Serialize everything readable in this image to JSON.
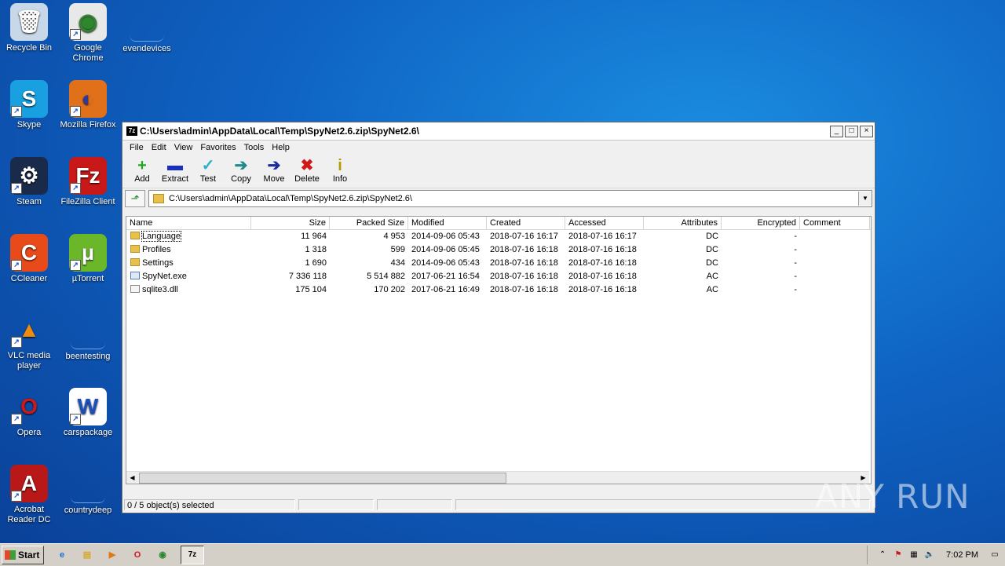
{
  "desktop": {
    "icons": [
      {
        "label": "Recycle Bin",
        "icon": "recycle-bin"
      },
      {
        "label": "Google Chrome",
        "icon": "chrome"
      },
      {
        "label": "evendevices",
        "icon": "blank"
      },
      {
        "label": "Skype",
        "icon": "skype"
      },
      {
        "label": "Mozilla Firefox",
        "icon": "firefox"
      },
      {
        "label": "Steam",
        "icon": "steam"
      },
      {
        "label": "FileZilla Client",
        "icon": "filezilla"
      },
      {
        "label": "CCleaner",
        "icon": "ccleaner"
      },
      {
        "label": "µTorrent",
        "icon": "utorrent"
      },
      {
        "label": "VLC media player",
        "icon": "vlc"
      },
      {
        "label": "beentesting",
        "icon": "blank"
      },
      {
        "label": "Opera",
        "icon": "opera"
      },
      {
        "label": "carspackage",
        "icon": "word-doc"
      },
      {
        "label": "Acrobat Reader DC",
        "icon": "acrobat"
      },
      {
        "label": "countrydeep",
        "icon": "blank"
      }
    ]
  },
  "window": {
    "title": "C:\\Users\\admin\\AppData\\Local\\Temp\\SpyNet2.6.zip\\SpyNet2.6\\",
    "app_icon": "7z",
    "controls": {
      "minimize": "_",
      "maximize": "□",
      "close": "×"
    },
    "menu": [
      "File",
      "Edit",
      "View",
      "Favorites",
      "Tools",
      "Help"
    ],
    "toolbar": [
      {
        "label": "Add",
        "icon": "plus-icon",
        "glyph": "+",
        "color": "#1fa81f"
      },
      {
        "label": "Extract",
        "icon": "minus-icon",
        "glyph": "▬",
        "color": "#1a2fbf"
      },
      {
        "label": "Test",
        "icon": "check-icon",
        "glyph": "✓",
        "color": "#2ab0c8"
      },
      {
        "label": "Copy",
        "icon": "copy-arrow-icon",
        "glyph": "➔",
        "color": "#1f8a8a"
      },
      {
        "label": "Move",
        "icon": "move-arrow-icon",
        "glyph": "➔",
        "color": "#1a2a9a"
      },
      {
        "label": "Delete",
        "icon": "delete-x-icon",
        "glyph": "✖",
        "color": "#d01818"
      },
      {
        "label": "Info",
        "icon": "info-icon",
        "glyph": "i",
        "color": "#b89a00"
      }
    ],
    "address": "C:\\Users\\admin\\AppData\\Local\\Temp\\SpyNet2.6.zip\\SpyNet2.6\\",
    "columns": [
      "Name",
      "Size",
      "Packed Size",
      "Modified",
      "Created",
      "Accessed",
      "Attributes",
      "Encrypted",
      "Comment"
    ],
    "rows": [
      {
        "name": "Language",
        "type": "folder",
        "size": "11 964",
        "packed": "4 953",
        "modified": "2014-09-06 05:43",
        "created": "2018-07-16 16:17",
        "accessed": "2018-07-16 16:17",
        "attributes": "DC",
        "encrypted": "-",
        "comment": ""
      },
      {
        "name": "Profiles",
        "type": "folder",
        "size": "1 318",
        "packed": "599",
        "modified": "2014-09-06 05:45",
        "created": "2018-07-16 16:18",
        "accessed": "2018-07-16 16:18",
        "attributes": "DC",
        "encrypted": "-",
        "comment": ""
      },
      {
        "name": "Settings",
        "type": "folder",
        "size": "1 690",
        "packed": "434",
        "modified": "2014-09-06 05:43",
        "created": "2018-07-16 16:18",
        "accessed": "2018-07-16 16:18",
        "attributes": "DC",
        "encrypted": "-",
        "comment": ""
      },
      {
        "name": "SpyNet.exe",
        "type": "exe",
        "size": "7 336 118",
        "packed": "5 514 882",
        "modified": "2017-06-21 16:54",
        "created": "2018-07-16 16:18",
        "accessed": "2018-07-16 16:18",
        "attributes": "AC",
        "encrypted": "-",
        "comment": ""
      },
      {
        "name": "sqlite3.dll",
        "type": "dll",
        "size": "175 104",
        "packed": "170 202",
        "modified": "2017-06-21 16:49",
        "created": "2018-07-16 16:18",
        "accessed": "2018-07-16 16:18",
        "attributes": "AC",
        "encrypted": "-",
        "comment": ""
      }
    ],
    "status": [
      "0 / 5 object(s) selected",
      "",
      "",
      ""
    ]
  },
  "taskbar": {
    "start_label": "Start",
    "pinned": [
      {
        "icon": "ie-icon",
        "glyph": "e",
        "color": "#1a6fd0"
      },
      {
        "icon": "explorer-icon",
        "glyph": "▤",
        "color": "#d8a82a"
      },
      {
        "icon": "media-player-icon",
        "glyph": "▶",
        "color": "#e07a10"
      },
      {
        "icon": "opera-icon",
        "glyph": "O",
        "color": "#d01818"
      },
      {
        "icon": "chrome-icon",
        "glyph": "◉",
        "color": "#2a8a2a"
      }
    ],
    "active_app": "7z",
    "clock": "7:02 PM"
  },
  "watermark": "ANY RUN"
}
